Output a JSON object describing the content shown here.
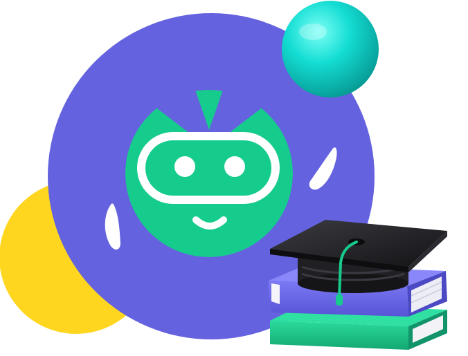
{
  "illustration": {
    "icons": {
      "blob": "yellow-blob",
      "circle": "purple-circle",
      "sphere": "teal-sphere",
      "bot": "robot-face-icon",
      "cap": "graduation-cap-icon",
      "books": "book-stack-icon"
    },
    "colors": {
      "purple": "#6462DE",
      "yellow": "#FFD61F",
      "green": "#16CC8C",
      "teal": "#12D6CE",
      "white": "#FFFFFF",
      "cap": "#1B1B1F",
      "book_purple": "#6F6CEE",
      "book_green": "#20C98C"
    }
  }
}
